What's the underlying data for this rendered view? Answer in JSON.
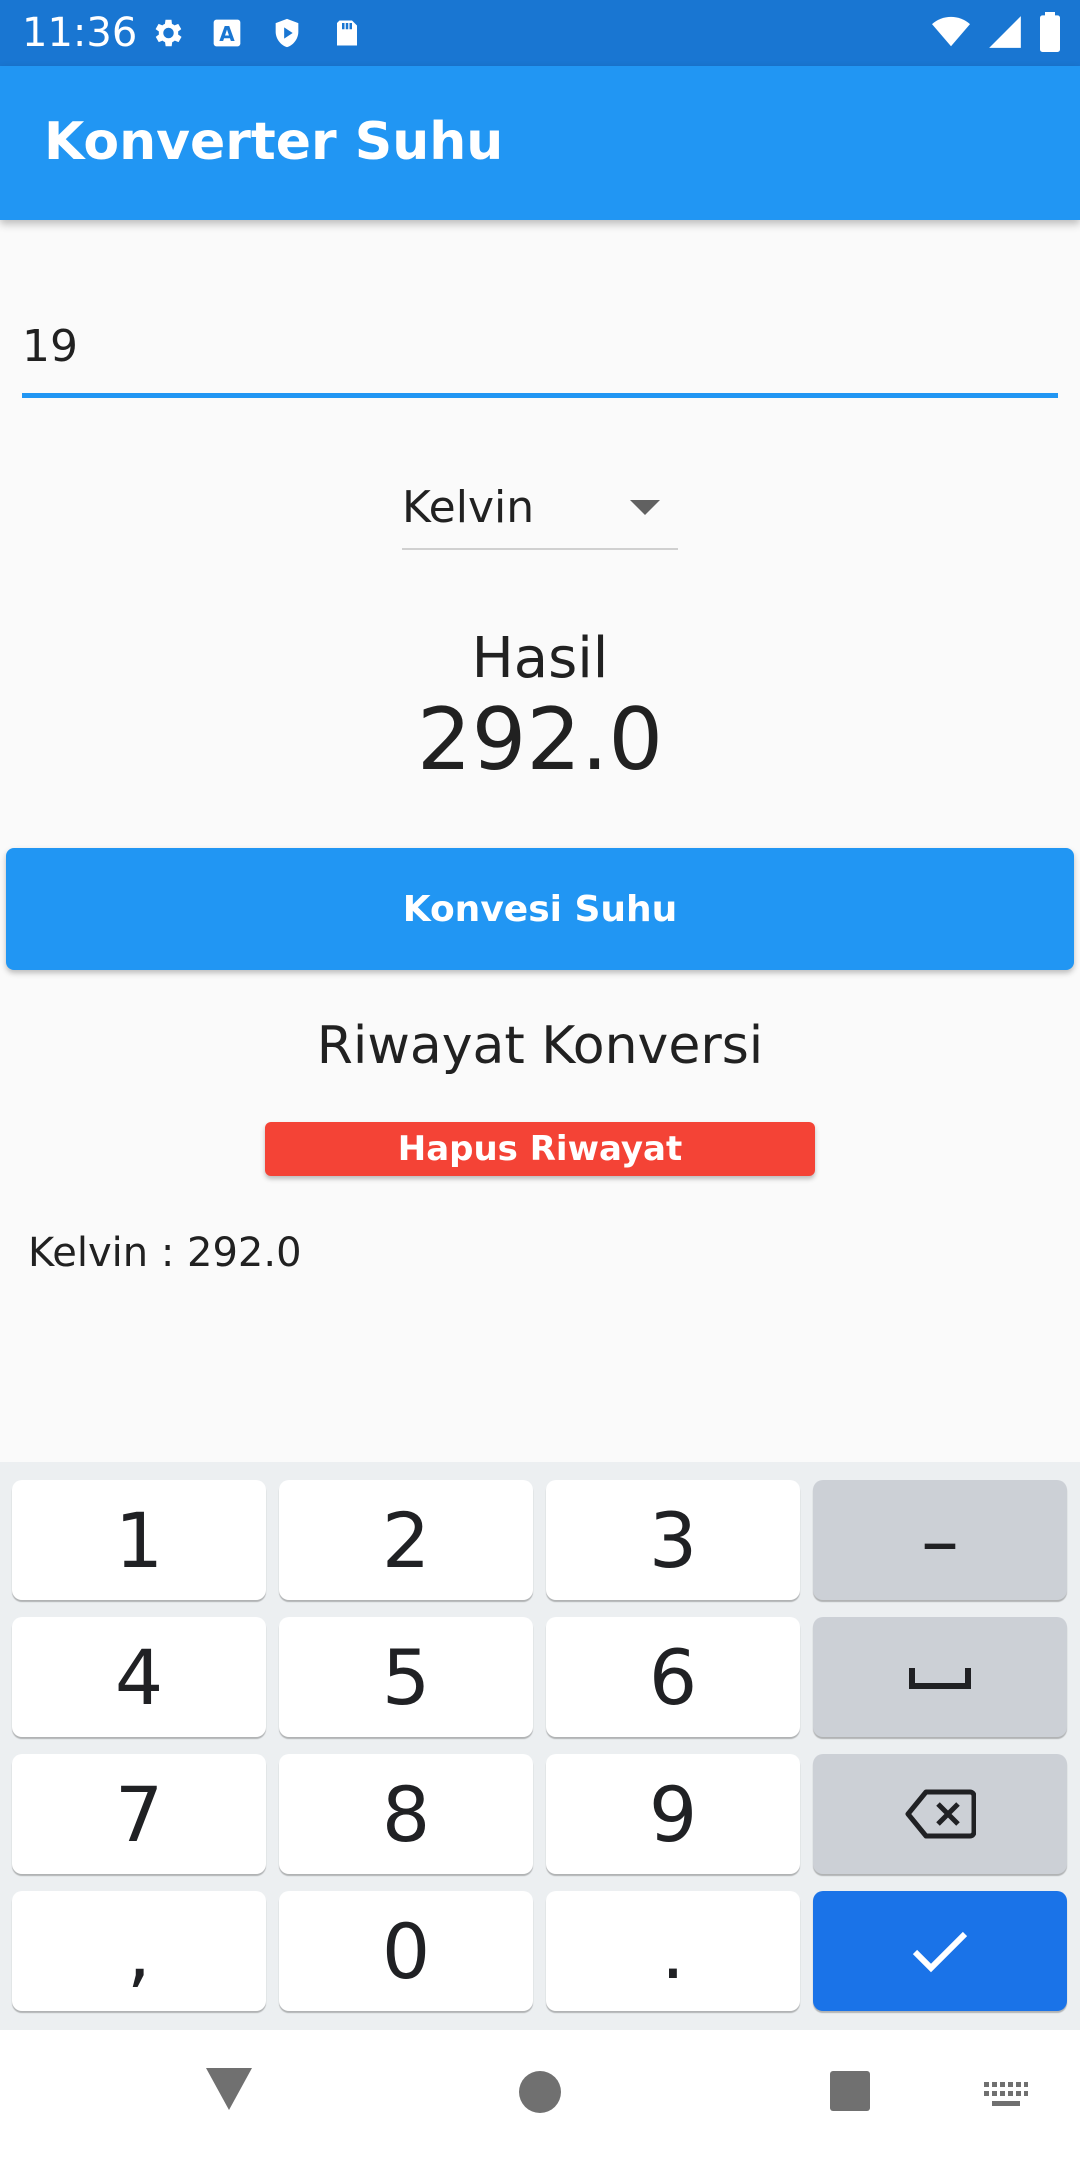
{
  "status_bar": {
    "time": "11:36",
    "icons": [
      "settings-icon",
      "accessibility-a-icon",
      "shield-play-icon",
      "sd-card-icon",
      "wifi-icon",
      "signal-icon",
      "battery-icon"
    ],
    "color": "#1976d2"
  },
  "app_bar": {
    "title": "Konverter Suhu",
    "color": "#2196f3"
  },
  "input": {
    "value": "19"
  },
  "dropdown": {
    "selected": "Kelvin"
  },
  "result": {
    "label": "Hasil",
    "value": "292.0"
  },
  "convert_button": {
    "label": "Konvesi Suhu",
    "color": "#2196f3"
  },
  "history": {
    "title": "Riwayat Konversi",
    "clear_label": "Hapus Riwayat",
    "clear_color": "#f44336",
    "items": [
      "Kelvin : 292.0"
    ]
  },
  "keyboard": {
    "keys": [
      "1",
      "2",
      "3",
      "–",
      "4",
      "5",
      "6",
      "space",
      "7",
      "8",
      "9",
      "backspace",
      ",",
      "0",
      ".",
      "done"
    ]
  },
  "nav_bar": {
    "buttons": [
      "back-icon",
      "home-icon",
      "recents-icon",
      "keyboard-switch-icon"
    ]
  }
}
